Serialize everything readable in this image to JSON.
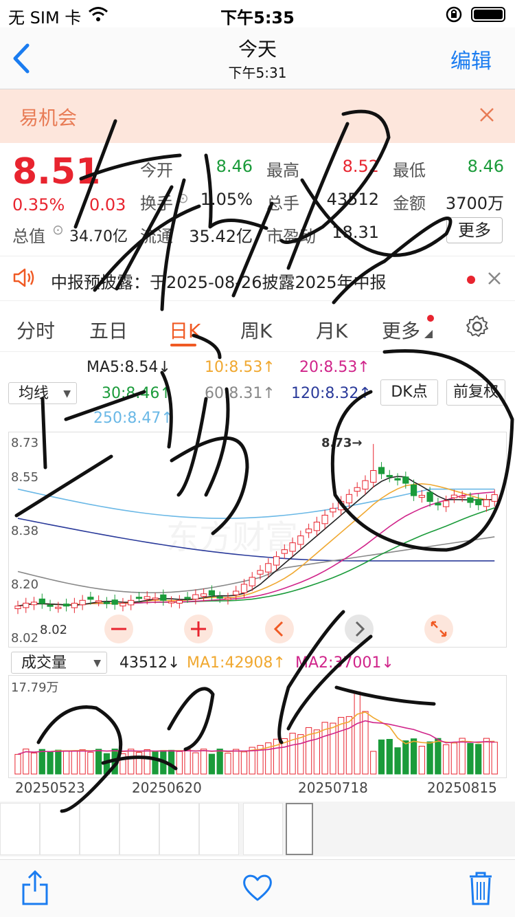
{
  "status_bar": {
    "carrier": "无 SIM 卡",
    "time": "下午5:35"
  },
  "nav": {
    "title": "今天",
    "subtitle": "下午5:31",
    "edit_label": "编辑"
  },
  "banner": {
    "text": "易机会"
  },
  "quote": {
    "price": "8.51",
    "change_pct": "0.35%",
    "change_abs": "0.03",
    "total_value_label": "总值",
    "total_value": "34.70亿",
    "float_label": "流通",
    "float_value": "35.42亿",
    "pe_label": "市盈动",
    "pe_value": "18.31",
    "open_label": "今开",
    "open_value": "8.46",
    "high_label": "最高",
    "high_value": "8.52",
    "low_label": "最低",
    "low_value": "8.46",
    "turnover_label": "换手",
    "turnover_value": "1.05%",
    "volume_label": "总手",
    "volume_value": "43512",
    "amount_label": "金额",
    "amount_value": "3700万",
    "more_label": "更多",
    "text_color_up": "#e8242f",
    "text_color_down": "#1a9b3a"
  },
  "notice": {
    "text": "中报预披露：于2025-08-26披露2025年中报"
  },
  "tabs": [
    "分时",
    "五日",
    "日K",
    "周K",
    "月K",
    "更多"
  ],
  "active_tab": "日K",
  "ma_legend": {
    "ma5": "MA5:8.54",
    "ma5_arrow": "↓",
    "ma10": "10:8.53",
    "ma10_arrow": "↑",
    "ma20": "20:8.53",
    "ma20_arrow": "↑",
    "ma30": "30:8.46",
    "ma30_arrow": "↑",
    "ma60": "60:8.31",
    "ma60_arrow": "↑",
    "ma120": "120:8.32",
    "ma120_arrow": "↑",
    "ma250": "250:8.47",
    "ma250_arrow": "↑",
    "indicator_select": "均线",
    "dk_label": "DK点",
    "adjust_label": "前复权"
  },
  "colors": {
    "ma5": "#222222",
    "ma10": "#f0a830",
    "ma20": "#d0248a",
    "ma30": "#1a9b3a",
    "ma60": "#888888",
    "ma120": "#2a3a9a",
    "ma250": "#6ab8e6",
    "up": "#e8242f",
    "down": "#1a9b3a"
  },
  "kline": {
    "y_ticks": [
      "8.73",
      "8.55",
      "8.38",
      "8.20",
      "8.02"
    ],
    "max_label": "8.73→",
    "min_label": "8.02",
    "watermark": "东方财富"
  },
  "volume": {
    "select_label": "成交量",
    "current": "43512",
    "current_arrow": "↓",
    "ma1": "MA1:42908",
    "ma1_arrow": "↑",
    "ma2": "MA2:37001",
    "ma2_arrow": "↓",
    "max_label": "17.79万"
  },
  "dates": [
    "20250523",
    "20250620",
    "20250718",
    "20250815"
  ]
}
